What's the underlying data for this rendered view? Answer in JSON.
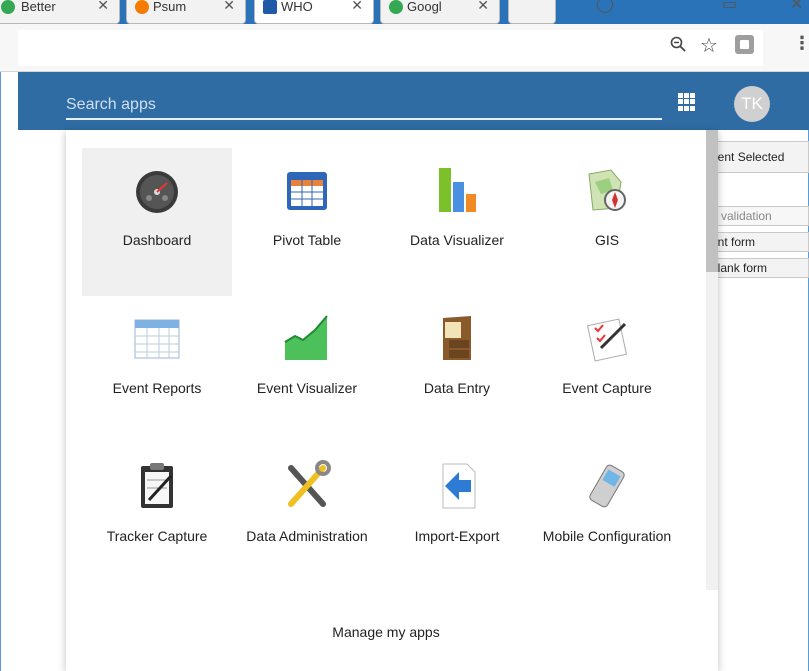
{
  "browser": {
    "tabs": [
      {
        "title": "Better",
        "favicon_color": "#34a853"
      },
      {
        "title": "Psum",
        "favicon_color": "#f57c00"
      },
      {
        "title": "WHO",
        "favicon_color": "#1e5aa8"
      },
      {
        "title": "Googl",
        "favicon_color": "#34a853"
      }
    ],
    "active_tab_index": 2,
    "tab_close_glyph": "✕"
  },
  "header": {
    "search_placeholder": "Search apps",
    "avatar_initials": "TK",
    "bar_color": "#2f6ca3"
  },
  "apps": [
    {
      "label": "Dashboard",
      "icon": "dashboard-gauge-icon"
    },
    {
      "label": "Pivot Table",
      "icon": "pivot-table-icon"
    },
    {
      "label": "Data Visualizer",
      "icon": "bar-chart-icon"
    },
    {
      "label": "GIS",
      "icon": "map-compass-icon"
    },
    {
      "label": "Event Reports",
      "icon": "spreadsheet-icon"
    },
    {
      "label": "Event Visualizer",
      "icon": "area-chart-icon"
    },
    {
      "label": "Data Entry",
      "icon": "filing-cabinet-icon"
    },
    {
      "label": "Event Capture",
      "icon": "checklist-pen-icon"
    },
    {
      "label": "Tracker Capture",
      "icon": "clipboard-icon"
    },
    {
      "label": "Data Administration",
      "icon": "tools-icon"
    },
    {
      "label": "Import-Export",
      "icon": "import-export-icon"
    },
    {
      "label": "Mobile Configuration",
      "icon": "mobile-phone-icon"
    }
  ],
  "manage_apps_label": "Manage my apps",
  "background": {
    "selected_button": "nent Selected",
    "validation_button": "n validation",
    "print_form_button": "rint form",
    "blank_form_button": "blank form"
  }
}
